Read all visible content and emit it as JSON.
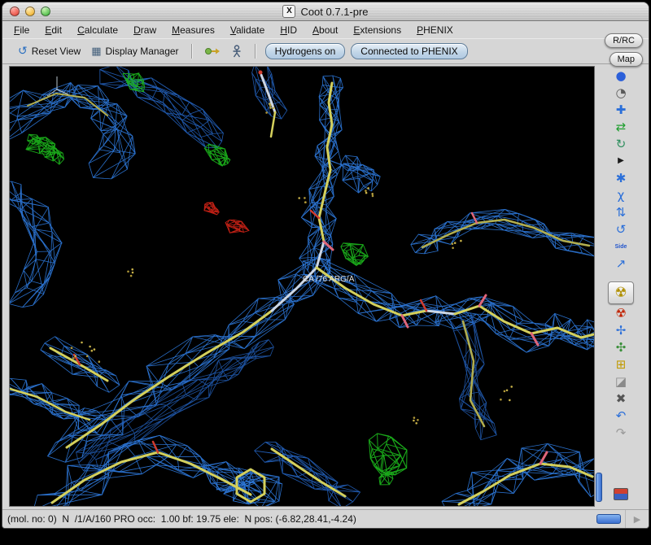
{
  "window": {
    "title": "Coot 0.7.1-pre",
    "icon_letter": "X"
  },
  "menu_bar": {
    "items": [
      {
        "label": "File"
      },
      {
        "label": "Edit"
      },
      {
        "label": "Calculate"
      },
      {
        "label": "Draw"
      },
      {
        "label": "Measures"
      },
      {
        "label": "Validate"
      },
      {
        "label": "HID"
      },
      {
        "label": "About"
      },
      {
        "label": "Extensions"
      },
      {
        "label": "PHENIX"
      }
    ]
  },
  "corner_buttons": {
    "rrc_label": "R/RC",
    "map_label": "Map"
  },
  "toolbar": {
    "reset_view_icon": "↺",
    "reset_view_label": "Reset View",
    "display_manager_icon": "▦",
    "display_manager_label": "Display Manager",
    "hydrogens_label": "Hydrogens on",
    "phenix_label": "Connected to PHENIX"
  },
  "canvas": {
    "atom_label": "CA /76 ARG/A"
  },
  "right_toolbar": {
    "icons": [
      {
        "name": "map-sphere-icon",
        "glyph": "●",
        "color": "#2b5fd9"
      },
      {
        "name": "clock-icon",
        "glyph": "◔",
        "color": "#5a5a5a"
      },
      {
        "name": "move-atoms-icon",
        "glyph": "✚",
        "color": "#2b6fd9"
      },
      {
        "name": "swap-arrows-icon",
        "glyph": "⇄",
        "color": "#1f9f2f"
      },
      {
        "name": "rotate-zone-icon",
        "glyph": "↻",
        "color": "#2f8f5f"
      },
      {
        "name": "play-icon",
        "glyph": "▶",
        "color": "#1a1a1a",
        "small": true
      },
      {
        "name": "auto-fit-rotamer-icon",
        "glyph": "✱",
        "color": "#2b6fd9"
      },
      {
        "name": "edit-chi-angles-icon",
        "glyph": "χ",
        "color": "#2b6fd9"
      },
      {
        "name": "flip-peptide-icon",
        "glyph": "⇅",
        "color": "#2b6fd9"
      },
      {
        "name": "rotate-ccw-icon",
        "glyph": "↺",
        "color": "#2b6fd9"
      },
      {
        "name": "side-chain-flip-icon",
        "glyph": "Side",
        "color": "#2255cc",
        "text_icon": true
      },
      {
        "name": "add-terminal-residue-icon",
        "glyph": "↗",
        "color": "#2b6fd9"
      },
      {
        "name": "sphere-refine-icon",
        "glyph": "☢",
        "color": "#b08f00",
        "selected": true,
        "gap_before": true
      },
      {
        "name": "radiation-icon",
        "glyph": "☢",
        "color": "#c22200"
      },
      {
        "name": "atom-cross-icon",
        "glyph": "✢",
        "color": "#2b6fd9"
      },
      {
        "name": "star-cross-icon",
        "glyph": "✣",
        "color": "#3a8f3a"
      },
      {
        "name": "add-atom-icon",
        "glyph": "⊞",
        "color": "#c09a00"
      },
      {
        "name": "eraser-icon",
        "glyph": "◪",
        "color": "#8a8a8a"
      },
      {
        "name": "delete-icon",
        "glyph": "✖",
        "color": "#555555"
      },
      {
        "name": "undo-icon",
        "glyph": "↶",
        "color": "#2b6fd9"
      },
      {
        "name": "redo-icon",
        "glyph": "↷",
        "color": "#9a9a9a"
      },
      {
        "name": "image-icon",
        "swatch": true,
        "push": true
      }
    ]
  },
  "status_bar": {
    "text": "(mol. no: 0)  N  /1/A/160 PRO occ:  1.00 bf: 19.75 ele:  N pos: (-6.82,28.41,-4.24)",
    "corner_glyph": "▶"
  },
  "colors": {
    "density_blue": "#2f7ce0",
    "density_blue_dim": "#2565c4",
    "diff_green": "#1dbb1d",
    "diff_red": "#d42418",
    "model_yellow": "#d4d05c",
    "model_yellow_dim": "#b2ae4e",
    "model_pale": "#ccd6e4",
    "model_pink": "#e0667a",
    "model_red": "#d03c30",
    "water_dot": "#c6b048"
  }
}
